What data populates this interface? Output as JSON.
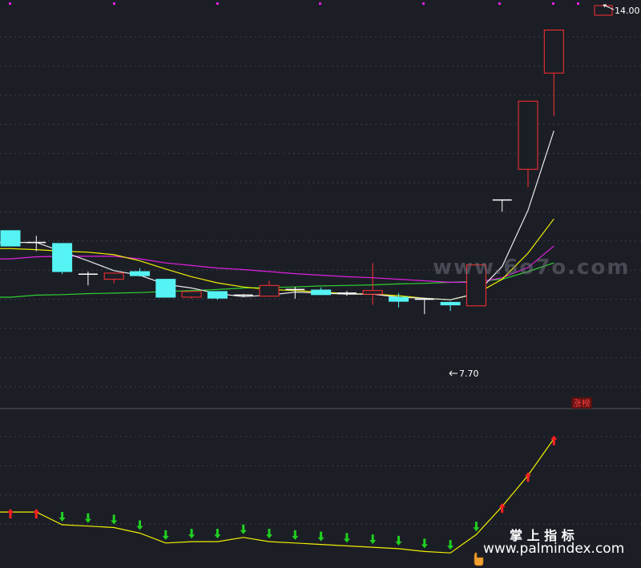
{
  "watermarks": {
    "top": "www.6o7o.com",
    "bottom_cn": "掌 上 指 标",
    "bottom_url": "www.palmindex.com"
  },
  "main_panel": {
    "high_label": "14.00",
    "low_label": "7.70",
    "limit_up_tag": "涨榜"
  },
  "colors": {
    "background": "#1c1e26",
    "up": "#ff3030",
    "down": "#55f3f3",
    "ma_white": "#e8e8e8",
    "ma_yellow": "#f0f000",
    "ma_magenta": "#e020e0",
    "ma_green": "#30d030",
    "indicator_line": "#f0f000",
    "arrow_up": "#ff2020",
    "arrow_down": "#20d020",
    "grid": "#3a3d48"
  },
  "chart_data": {
    "type": "candlestick",
    "ylim": [
      7.0,
      14.2
    ],
    "candles": [
      {
        "o": 9.85,
        "c": 9.55,
        "h": 9.85,
        "l": 9.55
      },
      {
        "o": 9.62,
        "c": 9.6,
        "h": 9.75,
        "l": 9.45
      },
      {
        "o": 9.6,
        "c": 9.05,
        "h": 9.6,
        "l": 9.0
      },
      {
        "o": 9.0,
        "c": 9.0,
        "h": 9.05,
        "l": 8.78
      },
      {
        "o": 8.9,
        "c": 9.02,
        "h": 9.02,
        "l": 8.82
      },
      {
        "o": 9.05,
        "c": 8.97,
        "h": 9.12,
        "l": 8.95
      },
      {
        "o": 8.9,
        "c": 8.55,
        "h": 8.9,
        "l": 8.55
      },
      {
        "o": 8.55,
        "c": 8.66,
        "h": 8.66,
        "l": 8.52
      },
      {
        "o": 8.66,
        "c": 8.53,
        "h": 8.66,
        "l": 8.5
      },
      {
        "o": 8.56,
        "c": 8.59,
        "h": 8.61,
        "l": 8.55
      },
      {
        "o": 8.57,
        "c": 8.78,
        "h": 8.87,
        "l": 8.57
      },
      {
        "o": 8.67,
        "c": 8.7,
        "h": 8.75,
        "l": 8.52
      },
      {
        "o": 8.69,
        "c": 8.6,
        "h": 8.74,
        "l": 8.6
      },
      {
        "o": 8.61,
        "c": 8.63,
        "h": 8.67,
        "l": 8.58
      },
      {
        "o": 8.61,
        "c": 8.68,
        "h": 9.22,
        "l": 8.4
      },
      {
        "o": 8.55,
        "c": 8.47,
        "h": 8.63,
        "l": 8.35
      },
      {
        "o": 8.51,
        "c": 8.51,
        "h": 8.51,
        "l": 8.22
      },
      {
        "o": 8.45,
        "c": 8.4,
        "h": 8.47,
        "l": 8.28
      },
      {
        "o": 8.38,
        "c": 9.18,
        "h": 9.18,
        "l": 8.38
      },
      {
        "o": 10.45,
        "c": 10.45,
        "h": 10.45,
        "l": 10.22
      },
      {
        "o": 11.05,
        "c": 12.38,
        "h": 12.38,
        "l": 10.7
      },
      {
        "o": 12.93,
        "c": 13.77,
        "h": 13.77,
        "l": 12.09
      }
    ],
    "ma_white": [
      9.62,
      9.62,
      9.44,
      9.26,
      9.07,
      8.98,
      8.8,
      8.73,
      8.62,
      8.56,
      8.59,
      8.65,
      8.63,
      8.61,
      8.61,
      8.55,
      8.53,
      8.5,
      8.62,
      9.15,
      10.25,
      11.8
    ],
    "ma_yellow": [
      9.5,
      9.48,
      9.45,
      9.43,
      9.38,
      9.26,
      9.1,
      8.95,
      8.83,
      8.75,
      8.7,
      8.68,
      8.65,
      8.62,
      8.61,
      8.58,
      8.53,
      8.5,
      8.62,
      8.9,
      9.41,
      10.08
    ],
    "ma_magenta": [
      9.3,
      9.34,
      9.35,
      9.35,
      9.35,
      9.3,
      9.22,
      9.17,
      9.12,
      9.09,
      9.05,
      9.01,
      8.98,
      8.95,
      8.93,
      8.9,
      8.87,
      8.84,
      8.84,
      8.93,
      9.13,
      9.55
    ],
    "ma_green": [
      8.55,
      8.59,
      8.6,
      8.62,
      8.63,
      8.64,
      8.66,
      8.68,
      8.7,
      8.73,
      8.74,
      8.75,
      8.77,
      8.78,
      8.79,
      8.81,
      8.82,
      8.84,
      8.86,
      8.9,
      9.05,
      9.22
    ],
    "indicator": {
      "ylim": [
        0,
        100
      ],
      "line": [
        38,
        38,
        29,
        28,
        27,
        23,
        16,
        17,
        17,
        20,
        17,
        16,
        15,
        14,
        13,
        12,
        10,
        9,
        22,
        42,
        64,
        90
      ],
      "arrows": [
        "up",
        "up",
        "down",
        "down",
        "down",
        "down",
        "down",
        "down",
        "down",
        "down",
        "down",
        "down",
        "down",
        "down",
        "down",
        "down",
        "down",
        "down",
        "down",
        "up",
        "up",
        "up"
      ]
    }
  }
}
